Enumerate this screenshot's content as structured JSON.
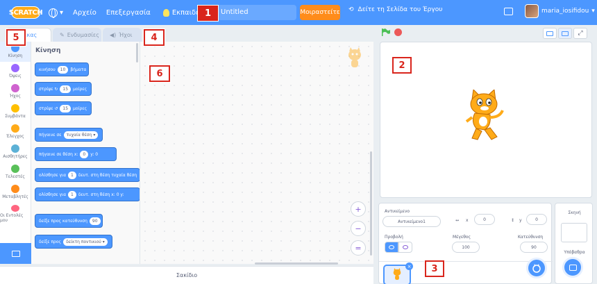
{
  "menubar": {
    "logo": "SCRATCH",
    "file": "Αρχείο",
    "edit": "Επεξεργασία",
    "tutorials": "Εκπαιδευτικά υλικά",
    "project_title": "Untitled",
    "share": "Μοιραστείτε",
    "see_project": "Δείτε τη Σελίδα του Έργου",
    "username": "maria_iosifidou"
  },
  "markers": [
    "1",
    "2",
    "3",
    "4",
    "5",
    "6"
  ],
  "tabs": {
    "code": "Κώδικας",
    "costumes": "Ενδυμασίες",
    "sounds": "Ήχοι"
  },
  "categories": [
    {
      "label": "Κίνηση",
      "color": "#4c97ff"
    },
    {
      "label": "Όψεις",
      "color": "#9966ff"
    },
    {
      "label": "Ήχος",
      "color": "#cf63cf"
    },
    {
      "label": "Συμβάντα",
      "color": "#ffbf00"
    },
    {
      "label": "Έλεγχος",
      "color": "#ffab19"
    },
    {
      "label": "Αισθητήρες",
      "color": "#5cb1d6"
    },
    {
      "label": "Τελεστές",
      "color": "#59c059"
    },
    {
      "label": "Μεταβλητές",
      "color": "#ff8c1a"
    },
    {
      "label": "Οι Εντολές μου",
      "color": "#ff6680"
    }
  ],
  "palette": {
    "heading": "Κίνηση",
    "blocks": [
      {
        "pre": "κινήσου",
        "val": "10",
        "post": "βήματα"
      },
      {
        "pre": "στρίψε ↻",
        "val": "15",
        "post": "μοίρες"
      },
      {
        "pre": "στρίψε ↺",
        "val": "15",
        "post": "μοίρες"
      },
      {
        "pre": "πήγαινε σε",
        "val": "τυχαία θέση ▾",
        "post": ""
      },
      {
        "pre": "πήγαινε σε θέση x:",
        "val": "0",
        "post": "y: 0"
      },
      {
        "pre": "ολίσθησε για",
        "val": "1",
        "post": "δευτ. στη θέση  τυχαία θέση"
      },
      {
        "pre": "ολίσθησε για",
        "val": "1",
        "post": "δευτ. στη θέση x: 0 y:"
      },
      {
        "pre": "δείξε προς κατεύθυνση",
        "val": "90",
        "post": ""
      },
      {
        "pre": "δείξε προς",
        "val": "δείκτη ποντικιού ▾",
        "post": ""
      }
    ]
  },
  "backpack": "Σακίδιο",
  "zoom": {
    "in": "+",
    "out": "−",
    "reset": "="
  },
  "sprite_info": {
    "sprite_label": "Αντικείμενο",
    "sprite_name": "Αντικείμενο1",
    "x_label": "x",
    "x_value": "0",
    "y_label": "y",
    "y_value": "0",
    "show_label": "Προβολή",
    "size_label": "Μέγεθος",
    "size_value": "100",
    "direction_label": "Κατεύθυνση",
    "direction_value": "90"
  },
  "backdrop_pane": {
    "title": "Σκηνή",
    "label": "Υπόβαθρα"
  },
  "colors": {
    "accent": "#4c97ff",
    "marker": "#d9251c",
    "share": "#ff8c1a"
  }
}
